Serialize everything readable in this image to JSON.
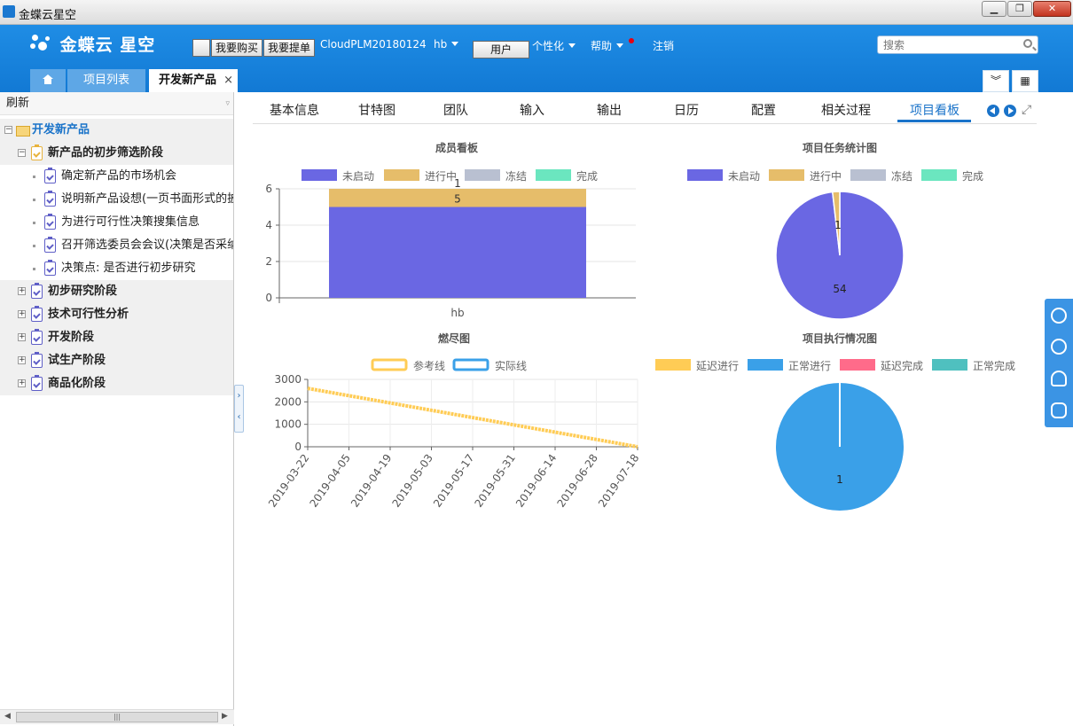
{
  "window": {
    "title": "金蝶云星空"
  },
  "header": {
    "logo_text": "金蝶云 星空",
    "buy_button": "我要购买",
    "request_button": "我要提单",
    "db_name": "CloudPLM20180124",
    "user_name": "hb",
    "role_button": "用户",
    "personalize": "个性化",
    "help": "帮助",
    "logout": "注销",
    "search_placeholder": "搜索"
  },
  "page_tabs": {
    "list": "项目列表",
    "active": "开发新产品",
    "close": "×"
  },
  "sidebar": {
    "refresh": "刷新",
    "root": "开发新产品",
    "phase1": "新产品的初步筛选阶段",
    "tasks": [
      "确定新产品的市场机会",
      "说明新产品设想(一页书面形式的披露",
      "为进行可行性决策搜集信息",
      "召开筛选委员会会议(决策是否采纳设",
      "决策点: 是否进行初步研究"
    ],
    "phases": [
      "初步研究阶段",
      "技术可行性分析",
      "开发阶段",
      "试生产阶段",
      "商品化阶段"
    ]
  },
  "content_tabs": [
    "基本信息",
    "甘特图",
    "团队",
    "输入",
    "输出",
    "日历",
    "配置",
    "相关过程",
    "项目看板"
  ],
  "colors": {
    "not_started": "#6a67e3",
    "in_progress": "#e6bd6a",
    "frozen": "#b9c0d1",
    "done": "#6be6bf",
    "reference": "#ffcc55",
    "actual": "#3aa0e8",
    "delayed_progress": "#ffcc55",
    "normal_progress": "#3aa0e8",
    "delayed_done": "#ff6b8a",
    "normal_done": "#4fc0bf"
  },
  "chart_data": [
    {
      "type": "bar",
      "title": "成员看板",
      "categories": [
        "hb"
      ],
      "series": [
        {
          "name": "未启动",
          "values": [
            5
          ]
        },
        {
          "name": "进行中",
          "values": [
            1
          ]
        },
        {
          "name": "冻结",
          "values": [
            0
          ]
        },
        {
          "name": "完成",
          "values": [
            0
          ]
        }
      ],
      "stacked": true,
      "ylim": [
        0,
        6
      ],
      "yticks": [
        "0",
        "2",
        "4",
        "6"
      ],
      "data_labels": [
        "5",
        "1"
      ]
    },
    {
      "type": "pie",
      "title": "项目任务统计图",
      "legend": [
        "未启动",
        "进行中",
        "冻结",
        "完成"
      ],
      "slices": [
        {
          "name": "未启动",
          "value": 54
        },
        {
          "name": "进行中",
          "value": 1
        }
      ],
      "data_labels": [
        "54",
        "1"
      ]
    },
    {
      "type": "line",
      "title": "燃尽图",
      "legend": [
        "参考线",
        "实际线"
      ],
      "xticks": [
        "2019-03-22",
        "2019-04-05",
        "2019-04-19",
        "2019-05-03",
        "2019-05-17",
        "2019-05-31",
        "2019-06-14",
        "2019-06-28",
        "2019-07-18"
      ],
      "yticks": [
        "0",
        "1000",
        "2000",
        "3000"
      ],
      "ylim": [
        0,
        3000
      ],
      "series": [
        {
          "name": "参考线",
          "start": {
            "x": "2019-03-22",
            "y": 2600
          },
          "end": {
            "x": "2019-07-18",
            "y": 0
          }
        }
      ]
    },
    {
      "type": "pie",
      "title": "项目执行情况图",
      "legend": [
        "延迟进行",
        "正常进行",
        "延迟完成",
        "正常完成"
      ],
      "slices": [
        {
          "name": "正常进行",
          "value": 1
        }
      ],
      "data_labels": [
        "1"
      ]
    }
  ]
}
